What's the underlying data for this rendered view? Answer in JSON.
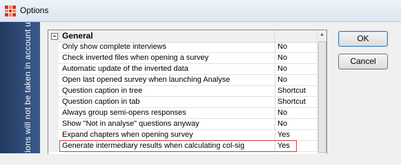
{
  "window": {
    "title": "Options"
  },
  "side_panel": {
    "text": "e options will not be taken in account u"
  },
  "grid": {
    "group": {
      "label": "General",
      "expander": "−"
    },
    "rows": [
      {
        "name": "Only show complete interviews",
        "value": "No"
      },
      {
        "name": "Check inverted files when opening a survey",
        "value": "No"
      },
      {
        "name": "Automatic update of the inverted data",
        "value": "No"
      },
      {
        "name": "Open last opened survey when launching Analyse",
        "value": "No"
      },
      {
        "name": "Question caption in tree",
        "value": "Shortcut"
      },
      {
        "name": "Question caption in tab",
        "value": "Shortcut"
      },
      {
        "name": "Always group semi-opens responses",
        "value": "No"
      },
      {
        "name": "Show \"Not in analyse\" questions anyway",
        "value": "No"
      },
      {
        "name": "Expand chapters when opening survey",
        "value": "Yes"
      },
      {
        "name": "Generate intermediary results when calculating col-sig",
        "value": "Yes",
        "highlighted": true
      }
    ]
  },
  "buttons": {
    "ok": "OK",
    "cancel": "Cancel"
  },
  "colors": {
    "highlight_border": "#d43a3a",
    "side_panel": "#2f4a75",
    "app_icon": "#e0302b"
  }
}
